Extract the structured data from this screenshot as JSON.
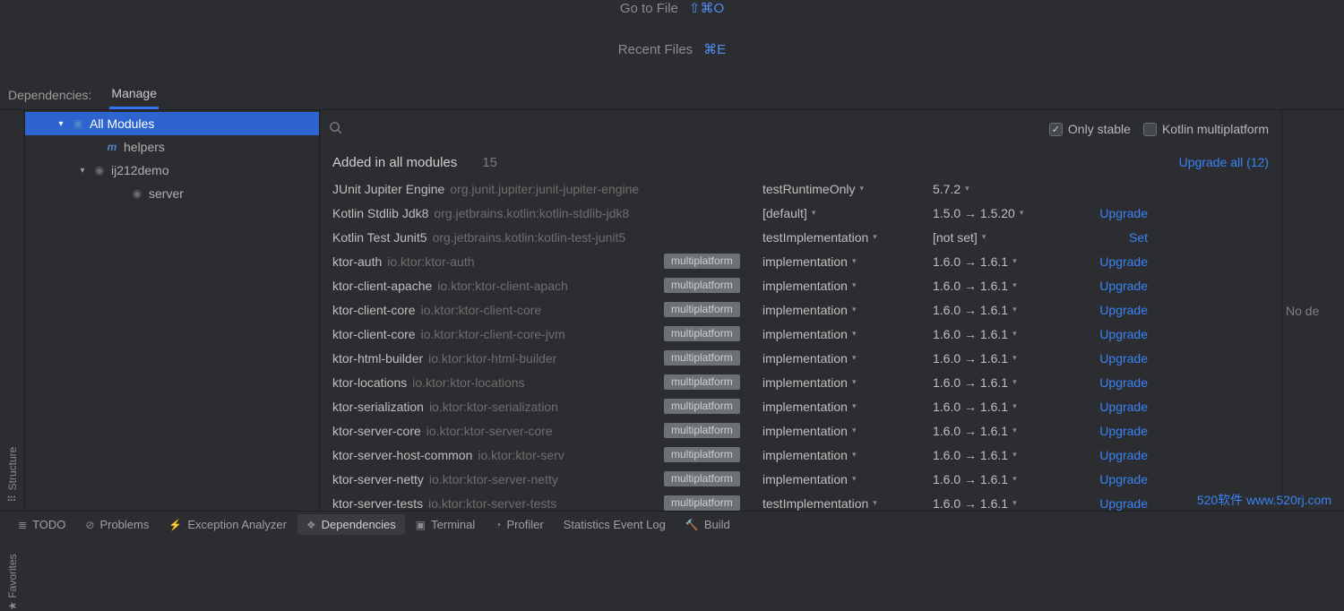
{
  "editor_hints": {
    "go_to_file": {
      "label": "Go to File",
      "shortcut": "⇧⌘O"
    },
    "recent_files": {
      "label": "Recent Files",
      "shortcut": "⌘E"
    }
  },
  "tabs": {
    "label_prefix": "Dependencies:",
    "active": "Manage"
  },
  "tree": {
    "all_modules": "All Modules",
    "helpers": "helpers",
    "demo": "ij212demo",
    "server": "server"
  },
  "left_tool": {
    "structure": "Structure",
    "favorites": "Favorites"
  },
  "filters": {
    "only_stable": "Only stable",
    "kmp": "Kotlin multiplatform"
  },
  "list_header": {
    "title": "Added in all modules",
    "count": "15",
    "upgrade_all": "Upgrade all (12)"
  },
  "badge_multiplatform": "multiplatform",
  "arrow": "→",
  "deps": [
    {
      "name": "JUnit Jupiter Engine",
      "coord": "org.junit.jupiter:junit-jupiter-engine",
      "badge": false,
      "scope": "testRuntimeOnly",
      "ver": "5.7.2",
      "action": ""
    },
    {
      "name": "Kotlin Stdlib Jdk8",
      "coord": "org.jetbrains.kotlin:kotlin-stdlib-jdk8",
      "badge": false,
      "scope": "[default]",
      "ver": "1.5.0 → 1.5.20",
      "action": "Upgrade"
    },
    {
      "name": "Kotlin Test Junit5",
      "coord": "org.jetbrains.kotlin:kotlin-test-junit5",
      "badge": false,
      "scope": "testImplementation",
      "ver": "[not set]",
      "action": "Set"
    },
    {
      "name": "ktor-auth",
      "coord": "io.ktor:ktor-auth",
      "badge": true,
      "scope": "implementation",
      "ver": "1.6.0 → 1.6.1",
      "action": "Upgrade"
    },
    {
      "name": "ktor-client-apache",
      "coord": "io.ktor:ktor-client-apach",
      "badge": true,
      "scope": "implementation",
      "ver": "1.6.0 → 1.6.1",
      "action": "Upgrade"
    },
    {
      "name": "ktor-client-core",
      "coord": "io.ktor:ktor-client-core",
      "badge": true,
      "scope": "implementation",
      "ver": "1.6.0 → 1.6.1",
      "action": "Upgrade"
    },
    {
      "name": "ktor-client-core",
      "coord": "io.ktor:ktor-client-core-jvm",
      "badge": true,
      "scope": "implementation",
      "ver": "1.6.0 → 1.6.1",
      "action": "Upgrade"
    },
    {
      "name": "ktor-html-builder",
      "coord": "io.ktor:ktor-html-builder",
      "badge": true,
      "scope": "implementation",
      "ver": "1.6.0 → 1.6.1",
      "action": "Upgrade"
    },
    {
      "name": "ktor-locations",
      "coord": "io.ktor:ktor-locations",
      "badge": true,
      "scope": "implementation",
      "ver": "1.6.0 → 1.6.1",
      "action": "Upgrade"
    },
    {
      "name": "ktor-serialization",
      "coord": "io.ktor:ktor-serialization",
      "badge": true,
      "scope": "implementation",
      "ver": "1.6.0 → 1.6.1",
      "action": "Upgrade"
    },
    {
      "name": "ktor-server-core",
      "coord": "io.ktor:ktor-server-core",
      "badge": true,
      "scope": "implementation",
      "ver": "1.6.0 → 1.6.1",
      "action": "Upgrade"
    },
    {
      "name": "ktor-server-host-common",
      "coord": "io.ktor:ktor-serv",
      "badge": true,
      "scope": "implementation",
      "ver": "1.6.0 → 1.6.1",
      "action": "Upgrade"
    },
    {
      "name": "ktor-server-netty",
      "coord": "io.ktor:ktor-server-netty",
      "badge": true,
      "scope": "implementation",
      "ver": "1.6.0 → 1.6.1",
      "action": "Upgrade"
    },
    {
      "name": "ktor-server-tests",
      "coord": "io.ktor:ktor-server-tests",
      "badge": true,
      "scope": "testImplementation",
      "ver": "1.6.0 → 1.6.1",
      "action": "Upgrade"
    }
  ],
  "right_hint": "No de",
  "bottom": {
    "todo": "TODO",
    "problems": "Problems",
    "exception": "Exception Analyzer",
    "dependencies": "Dependencies",
    "terminal": "Terminal",
    "profiler": "Profiler",
    "stats": "Statistics Event Log",
    "build": "Build"
  },
  "watermark": "520软件 www.520rj.com"
}
